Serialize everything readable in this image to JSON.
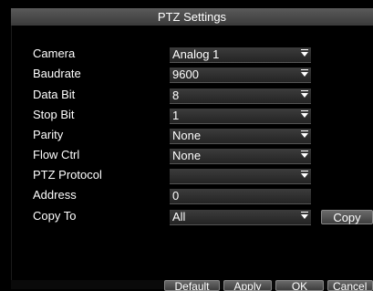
{
  "window": {
    "title": "PTZ Settings"
  },
  "form": {
    "camera": {
      "label": "Camera",
      "value": "Analog 1"
    },
    "baudrate": {
      "label": "Baudrate",
      "value": "9600"
    },
    "databit": {
      "label": "Data Bit",
      "value": "8"
    },
    "stopbit": {
      "label": "Stop Bit",
      "value": "1"
    },
    "parity": {
      "label": "Parity",
      "value": "None"
    },
    "flowctrl": {
      "label": "Flow Ctrl",
      "value": "None"
    },
    "protocol": {
      "label": "PTZ Protocol",
      "value": ""
    },
    "address": {
      "label": "Address",
      "value": "0"
    },
    "copyto": {
      "label": "Copy To",
      "value": "All"
    }
  },
  "buttons": {
    "copy": "Copy",
    "default": "Default",
    "apply": "Apply",
    "ok": "OK",
    "cancel": "Cancel"
  }
}
